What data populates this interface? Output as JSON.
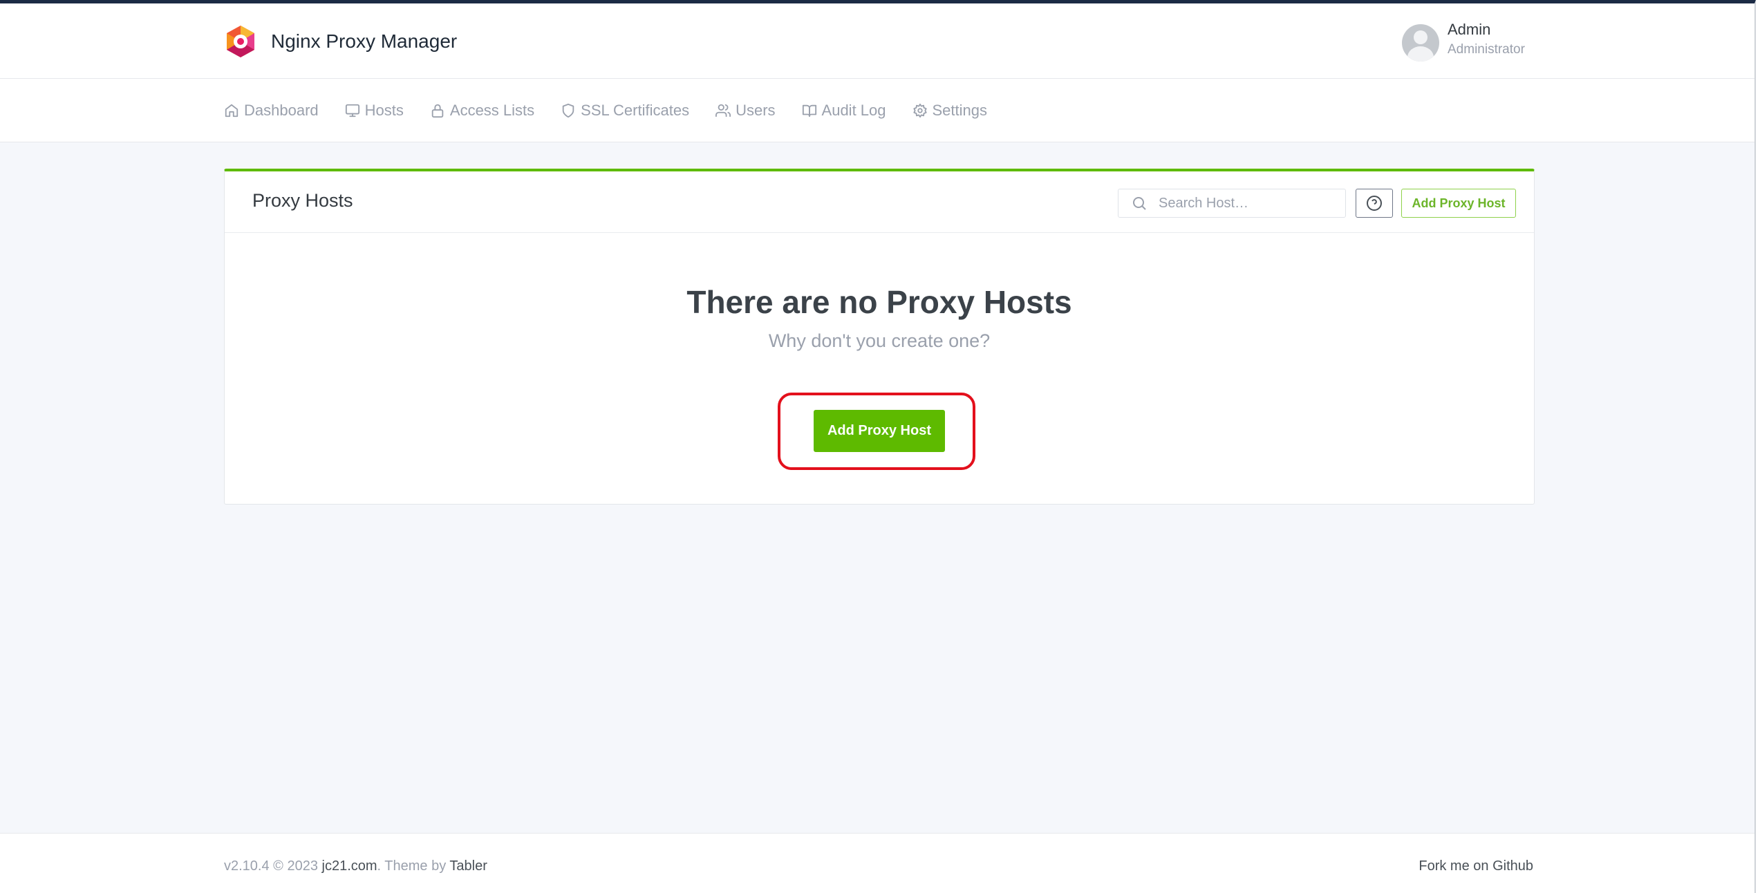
{
  "brand": {
    "name": "Nginx Proxy Manager",
    "logo_icon": "nginx-proxy-manager-logo"
  },
  "user": {
    "name": "Admin",
    "role": "Administrator"
  },
  "nav": {
    "items": [
      {
        "label": "Dashboard",
        "icon": "home-icon"
      },
      {
        "label": "Hosts",
        "icon": "monitor-icon"
      },
      {
        "label": "Access Lists",
        "icon": "lock-icon"
      },
      {
        "label": "SSL Certificates",
        "icon": "shield-icon"
      },
      {
        "label": "Users",
        "icon": "users-icon"
      },
      {
        "label": "Audit Log",
        "icon": "book-icon"
      },
      {
        "label": "Settings",
        "icon": "gear-icon"
      }
    ]
  },
  "card": {
    "title": "Proxy Hosts",
    "search_placeholder": "Search Host…",
    "header_add_label": "Add Proxy Host",
    "empty_title": "There are no Proxy Hosts",
    "empty_subtitle": "Why don't you create one?",
    "add_label": "Add Proxy Host"
  },
  "footer": {
    "version": "v2.10.4 © 2023 ",
    "company_link": "jc21.com",
    "theme_text": ". Theme by ",
    "theme_link": "Tabler",
    "github_link": "Fork me on Github"
  },
  "colors": {
    "accent": "#5eba00",
    "highlight": "#e3101c",
    "header_bar": "#1c2b45",
    "page_bg": "#f5f7fb"
  }
}
